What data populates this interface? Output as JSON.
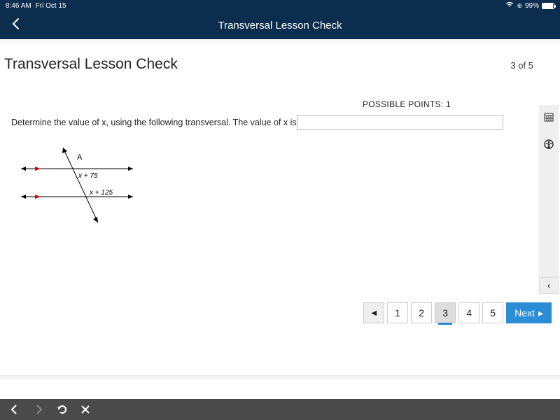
{
  "status": {
    "time": "8:46 AM",
    "date": "Fri Oct 15",
    "battery_pct": "99%"
  },
  "nav": {
    "title": "Transversal Lesson Check"
  },
  "lesson": {
    "title": "Transversal Lesson Check",
    "progress": "3 of 5"
  },
  "question": {
    "possible_points": "POSSIBLE POINTS: 1",
    "prompt": "Determine the value of x, using the following transversal. The value of x is",
    "answer_value": ""
  },
  "diagram": {
    "label_A": "A",
    "expr_top": "x + 75",
    "expr_bottom": "x + 125"
  },
  "pager": {
    "pages": [
      "1",
      "2",
      "3",
      "4",
      "5"
    ],
    "current": 3,
    "next_label": "Next"
  }
}
